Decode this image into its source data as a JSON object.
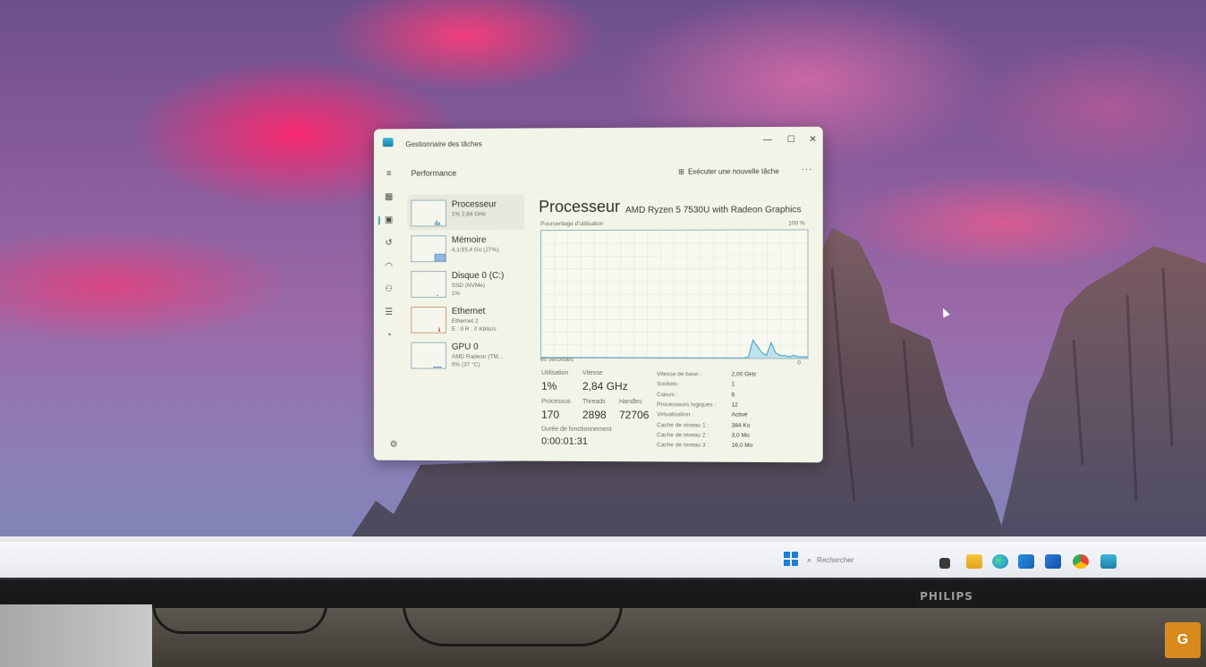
{
  "window": {
    "title": "Gestionnaire des tâches",
    "section": "Performance",
    "run_task": "Exécuter une nouvelle tâche",
    "more": "···"
  },
  "nav_icons": [
    "menu-icon",
    "processes-icon",
    "performance-icon",
    "history-icon",
    "startup-icon",
    "users-icon",
    "details-icon",
    "services-icon",
    "settings-icon"
  ],
  "perf_list": [
    {
      "name": "Processeur",
      "sub1": "1% 2,84 GHz",
      "sub2": ""
    },
    {
      "name": "Mémoire",
      "sub1": "4,1/15,4 Go (27%)",
      "sub2": ""
    },
    {
      "name": "Disque 0 (C:)",
      "sub1": "SSD (NVMe)",
      "sub2": "1%"
    },
    {
      "name": "Ethernet",
      "sub1": "Ethernet 2",
      "sub2": "E : 0 R : 0 Kbits/s"
    },
    {
      "name": "GPU 0",
      "sub1": "AMD Radeon (TM...",
      "sub2": "0% (37 °C)"
    }
  ],
  "cpu": {
    "title": "Processeur",
    "model": "AMD Ryzen 5 7530U with Radeon Graphics",
    "graph_label": "Pourcentage d'utilisation",
    "graph_max": "100 %",
    "graph_time": "60 secondes",
    "graph_min": "0",
    "graph_series": [
      0,
      0,
      0,
      0,
      0,
      0,
      0,
      0,
      0,
      0,
      0,
      0,
      0,
      0,
      0,
      0,
      0,
      0,
      0,
      0,
      0,
      0,
      0,
      0,
      0,
      0,
      0,
      0,
      0,
      0,
      0,
      0,
      0,
      0,
      0,
      0,
      0,
      0,
      0,
      0,
      0,
      0,
      0,
      0,
      0,
      0,
      1,
      14,
      9,
      4,
      2,
      12,
      4,
      2,
      2,
      1,
      2,
      1,
      1,
      1
    ],
    "stats": {
      "utilisation_label": "Utilisation",
      "utilisation": "1%",
      "vitesse_label": "Vitesse",
      "vitesse": "2,84 GHz",
      "processus_label": "Processus",
      "processus": "170",
      "threads_label": "Threads",
      "threads": "2898",
      "handles_label": "Handles",
      "handles": "72706",
      "uptime_label": "Durée de fonctionnement",
      "uptime": "0:00:01:31"
    },
    "specs": [
      {
        "k": "Vitesse de base :",
        "v": "2,00 GHz"
      },
      {
        "k": "Sockets :",
        "v": "1"
      },
      {
        "k": "Cœurs :",
        "v": "6"
      },
      {
        "k": "Processeurs logiques :",
        "v": "12"
      },
      {
        "k": "Virtualisation :",
        "v": "Activé"
      },
      {
        "k": "Cache de niveau 1 :",
        "v": "384 Ko"
      },
      {
        "k": "Cache de niveau 2 :",
        "v": "3,0 Mo"
      },
      {
        "k": "Cache de niveau 3 :",
        "v": "16,0 Mo"
      }
    ]
  },
  "taskbar": {
    "search_placeholder": "Rechercher",
    "icons": [
      "windows-start-icon",
      "task-view-icon",
      "file-explorer-icon",
      "edge-icon",
      "store-icon",
      "outlook-icon",
      "chrome-icon",
      "task-manager-icon"
    ]
  },
  "monitor": {
    "brand": "PHILIPS"
  },
  "badge": "G",
  "colors": {
    "accent": "#3fa5c8",
    "graph_fill": "#bfe3ee",
    "graph_line": "#3c9bbd",
    "window_bg": "#f2f4e7"
  }
}
